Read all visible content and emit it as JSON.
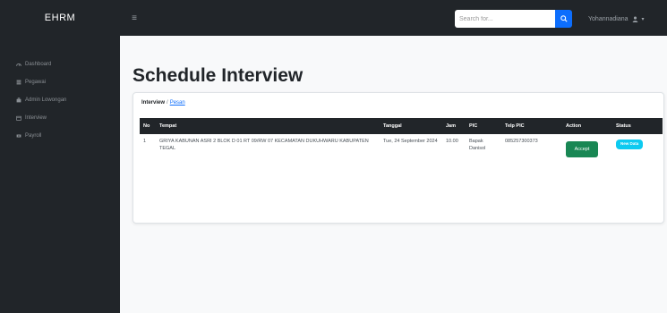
{
  "app": {
    "brand": "EHRM"
  },
  "topbar": {
    "menu_toggle_label": "≡",
    "search_placeholder": "Search for...",
    "user_name": "Yohannadiana"
  },
  "sidebar": {
    "items": [
      {
        "label": "Dashboard",
        "icon": "dashboard-icon"
      },
      {
        "label": "Pegawai",
        "icon": "users-icon"
      },
      {
        "label": "Admin Lowongan",
        "icon": "briefcase-icon"
      },
      {
        "label": "Interview",
        "icon": "calendar-icon"
      },
      {
        "label": "Payroll",
        "icon": "money-icon"
      }
    ]
  },
  "page": {
    "title": "Schedule Interview",
    "breadcrumb": {
      "current": "Interview",
      "sep": "/",
      "link": "Pesan"
    }
  },
  "table": {
    "headers": {
      "no": "No",
      "tempat": "Tempat",
      "tanggal": "Tanggal",
      "jam": "Jam",
      "pic": "PIC",
      "telp_pic": "Telp PIC",
      "action": "Action",
      "status": "Status"
    },
    "rows": [
      {
        "no": "1",
        "tempat": "GRIYA KABUNAN ASRI 2 BLOK D 01 RT 09/RW 07 KECAMATAN DUKUHWARU KABUPATEN TEGAL",
        "tanggal": "Tue, 24 September 2024",
        "jam": "10.00",
        "pic": "Bapak Danisol",
        "telp_pic": "085257300373",
        "action_label": "Accept",
        "status": "New Data"
      }
    ]
  },
  "colors": {
    "dark": "#212529",
    "primary": "#0d6efd",
    "success": "#198754",
    "info": "#0dcaf0"
  }
}
